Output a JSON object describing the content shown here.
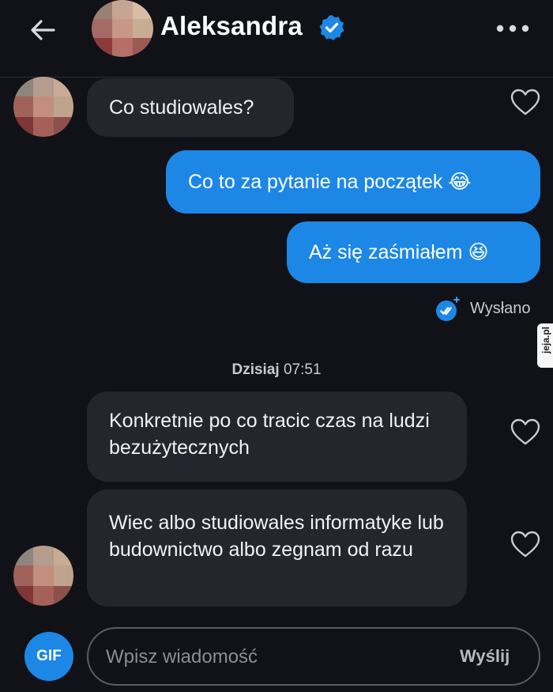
{
  "header": {
    "contact_name": "Aleksandra",
    "back_icon": "arrow-left-icon",
    "verified_icon": "verified-badge-icon",
    "more_icon": "more-dots-icon"
  },
  "messages": [
    {
      "direction": "incoming",
      "text": "Co studiowales?"
    },
    {
      "direction": "outgoing",
      "text": "Co to za pytanie na początek 😂"
    },
    {
      "direction": "outgoing",
      "text": "Aż się zaśmiałem 😆"
    },
    {
      "direction": "incoming",
      "text": "Konkretnie po co tracic czas na ludzi bezużytecznych"
    },
    {
      "direction": "incoming",
      "text": "Wiec albo studiowales informatyke lub budownictwo albo zegnam od razu"
    }
  ],
  "status": {
    "sent_label": "Wysłano"
  },
  "divider": {
    "day": "Dzisiaj",
    "time": "07:51"
  },
  "watermark": "jeja.pl",
  "composer": {
    "gif_label": "GIF",
    "placeholder": "Wpisz wiadomość",
    "send_label": "Wyślij"
  },
  "colors": {
    "background": "#111217",
    "incoming_bubble": "#24262e",
    "outgoing_bubble": "#1d87e6",
    "accent": "#1d87e6"
  }
}
